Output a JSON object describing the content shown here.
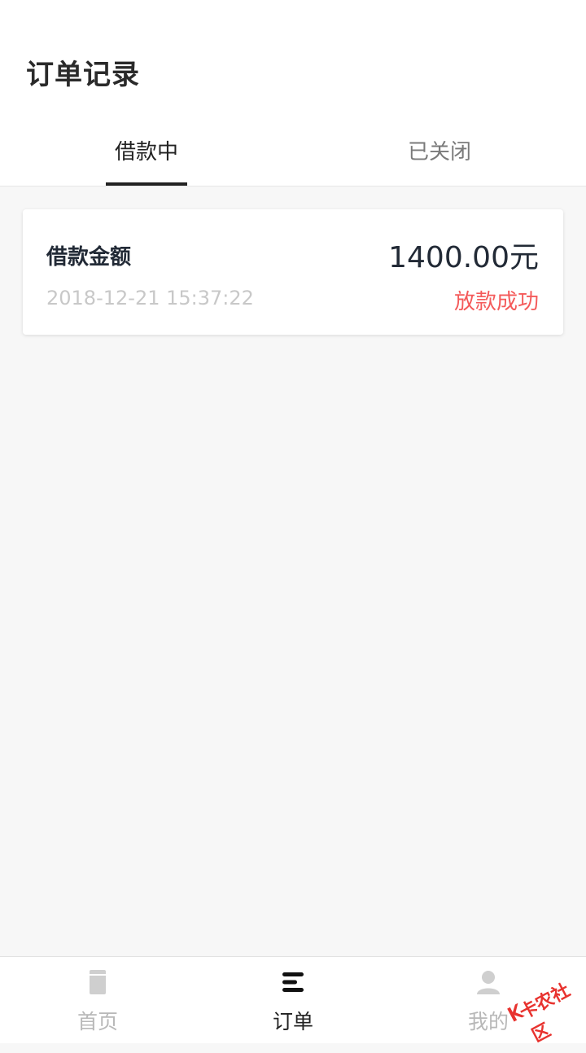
{
  "header": {
    "title": "订单记录"
  },
  "tabs": [
    {
      "label": "借款中",
      "active": true
    },
    {
      "label": "已关闭",
      "active": false
    }
  ],
  "orders": [
    {
      "label": "借款金额",
      "amount": "1400.00元",
      "datetime": "2018-12-21 15:37:22",
      "status": "放款成功"
    }
  ],
  "tabbar": {
    "items": [
      {
        "label": "首页",
        "icon": "home-document-icon",
        "active": false
      },
      {
        "label": "订单",
        "icon": "list-icon",
        "active": true
      },
      {
        "label": "我的",
        "icon": "user-icon",
        "active": false
      }
    ]
  },
  "watermark": {
    "text": "卡农社区"
  },
  "colors": {
    "accent_red": "#f45a5a",
    "text_dark": "#222a36",
    "muted": "#c8c8c8",
    "background": "#f7f7f7"
  }
}
